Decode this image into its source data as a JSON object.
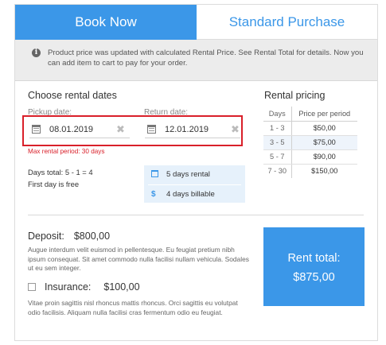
{
  "tabs": {
    "book_now": "Book Now",
    "standard_purchase": "Standard Purchase"
  },
  "notice": {
    "icon": "info-icon",
    "text": "Product price was updated with calculated Rental Price. See Rental Total for details. Now you can add item to cart to pay for your order."
  },
  "rental_dates": {
    "title": "Choose rental dates",
    "pickup": {
      "label": "Pickup date:",
      "value": "08.01.2019"
    },
    "return": {
      "label": "Return date:",
      "value": "12.01.2019"
    },
    "clear_symbol": "✖",
    "max_period": "Max rental period: 30 days",
    "days_total": "Days total: 5 - 1 = 4",
    "first_day": "First day is free"
  },
  "summary": {
    "rental_days": "5 days rental",
    "billable_days": "4 days billable",
    "dollar_symbol": "$"
  },
  "pricing": {
    "title": "Rental pricing",
    "headers": [
      "Days",
      "Price per period"
    ],
    "rows": [
      {
        "days": "1 - 3",
        "price": "$50,00"
      },
      {
        "days": "3 - 5",
        "price": "$75,00"
      },
      {
        "days": "5 - 7",
        "price": "$90,00"
      },
      {
        "days": "7 - 30",
        "price": "$150,00"
      }
    ]
  },
  "deposit": {
    "label": "Deposit:",
    "amount": "$800,00",
    "description": "Augue interdum velit euismod in pellentesque. Eu feugiat pretium nibh ipsum consequat. Sit amet commodo nulla facilisi nullam vehicula. Sodales ut eu sem integer."
  },
  "insurance": {
    "label": "Insurance:",
    "amount": "$100,00",
    "checked": false,
    "description": "Vitae proin sagittis nisl rhoncus mattis rhoncus. Orci sagittis eu volutpat odio facilisis. Aliquam nulla facilisi cras fermentum odio eu feugiat."
  },
  "rent_total": {
    "label": "Rent total:",
    "value": "$875,00"
  },
  "colors": {
    "accent": "#3b97e8",
    "error": "#d9202a"
  }
}
